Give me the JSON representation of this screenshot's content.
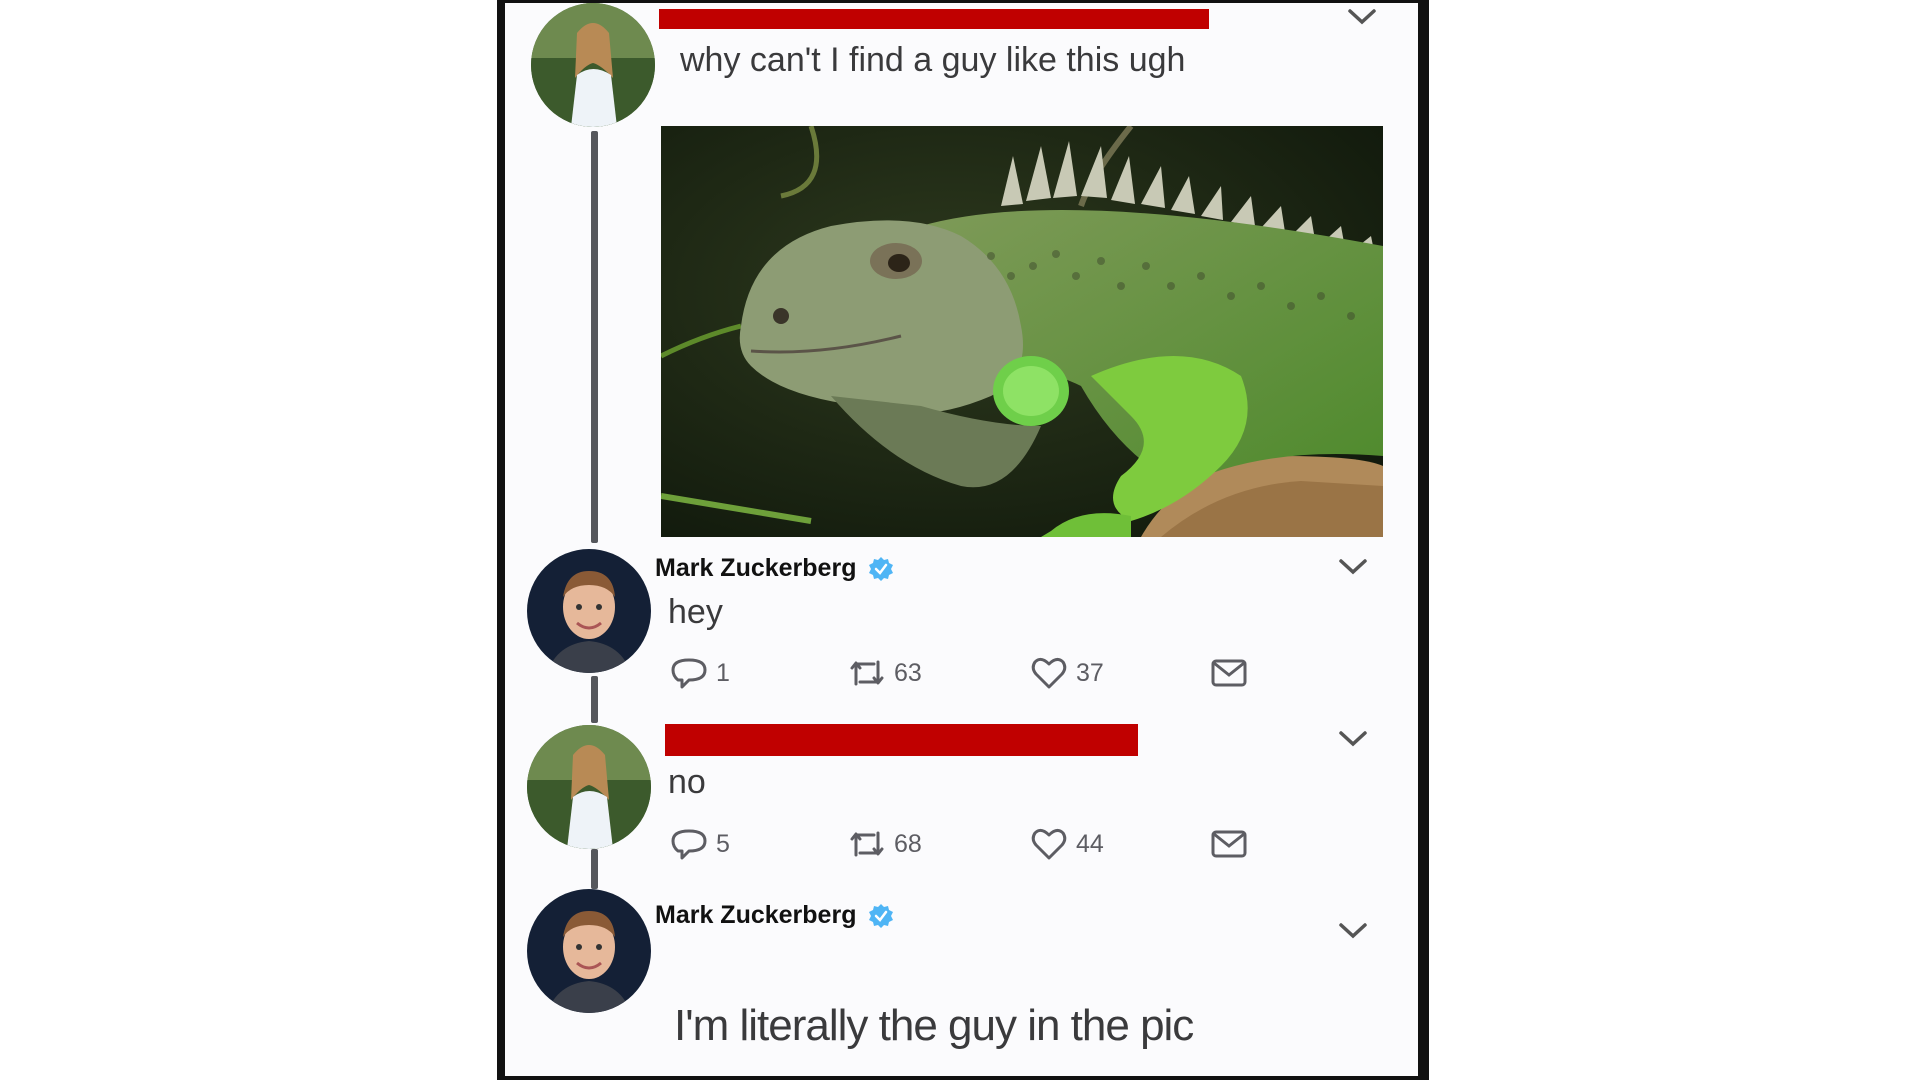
{
  "thread": {
    "tweet1": {
      "text": "why can't I find a guy like this ugh",
      "media_alt_icon": "iguana-photo"
    },
    "reply1": {
      "author": "Mark Zuckerberg",
      "text": "hey",
      "replies": "1",
      "retweets": "63",
      "likes": "37"
    },
    "reply2": {
      "text": "no",
      "replies": "5",
      "retweets": "68",
      "likes": "44"
    },
    "reply3": {
      "author": "Mark Zuckerberg",
      "text": "I'm literally the guy in the pic"
    }
  },
  "colors": {
    "redaction": "#c00000",
    "verified": "#4fb5f5",
    "thread_line": "#55575c"
  }
}
